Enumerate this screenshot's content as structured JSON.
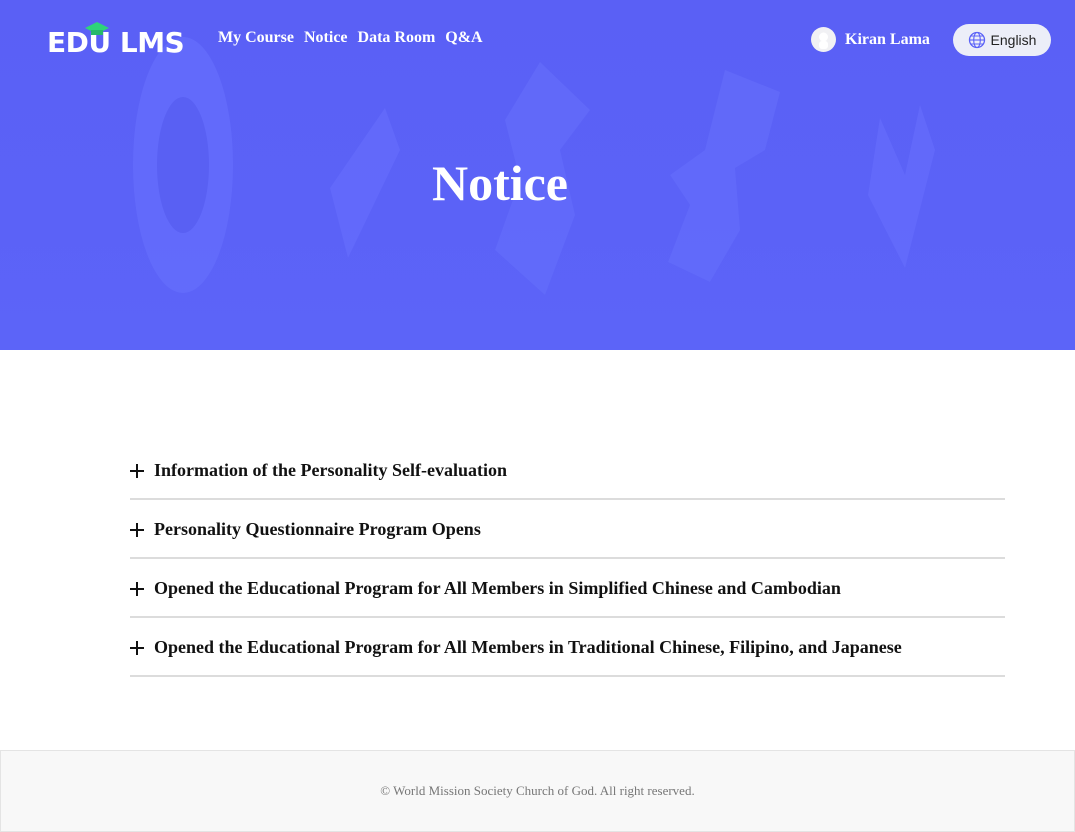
{
  "brand": {
    "logo_text": "EDU LMS",
    "logo_part1": "EDU",
    "logo_part2": "LMS",
    "accent_color": "#2ed47a"
  },
  "nav": {
    "items": [
      {
        "label": "My Course"
      },
      {
        "label": "Notice"
      },
      {
        "label": "Data Room"
      },
      {
        "label": "Q&A"
      }
    ]
  },
  "user": {
    "name": "Kiran Lama",
    "avatar_icon": "user-avatar-icon"
  },
  "language": {
    "label": "English",
    "icon": "globe-icon"
  },
  "hero": {
    "title": "Notice",
    "background_color": "#5b62f7"
  },
  "notices": [
    {
      "title": "Information of the Personality Self-evaluation",
      "icon": "plus-icon"
    },
    {
      "title": "Personality Questionnaire Program Opens",
      "icon": "plus-icon"
    },
    {
      "title": "Opened the Educational Program for All Members in Simplified Chinese and Cambodian",
      "icon": "plus-icon"
    },
    {
      "title": "Opened the Educational Program for All Members in Traditional Chinese, Filipino, and Japanese",
      "icon": "plus-icon"
    }
  ],
  "footer": {
    "copyright": "© World Mission Society Church of God. All right reserved."
  }
}
